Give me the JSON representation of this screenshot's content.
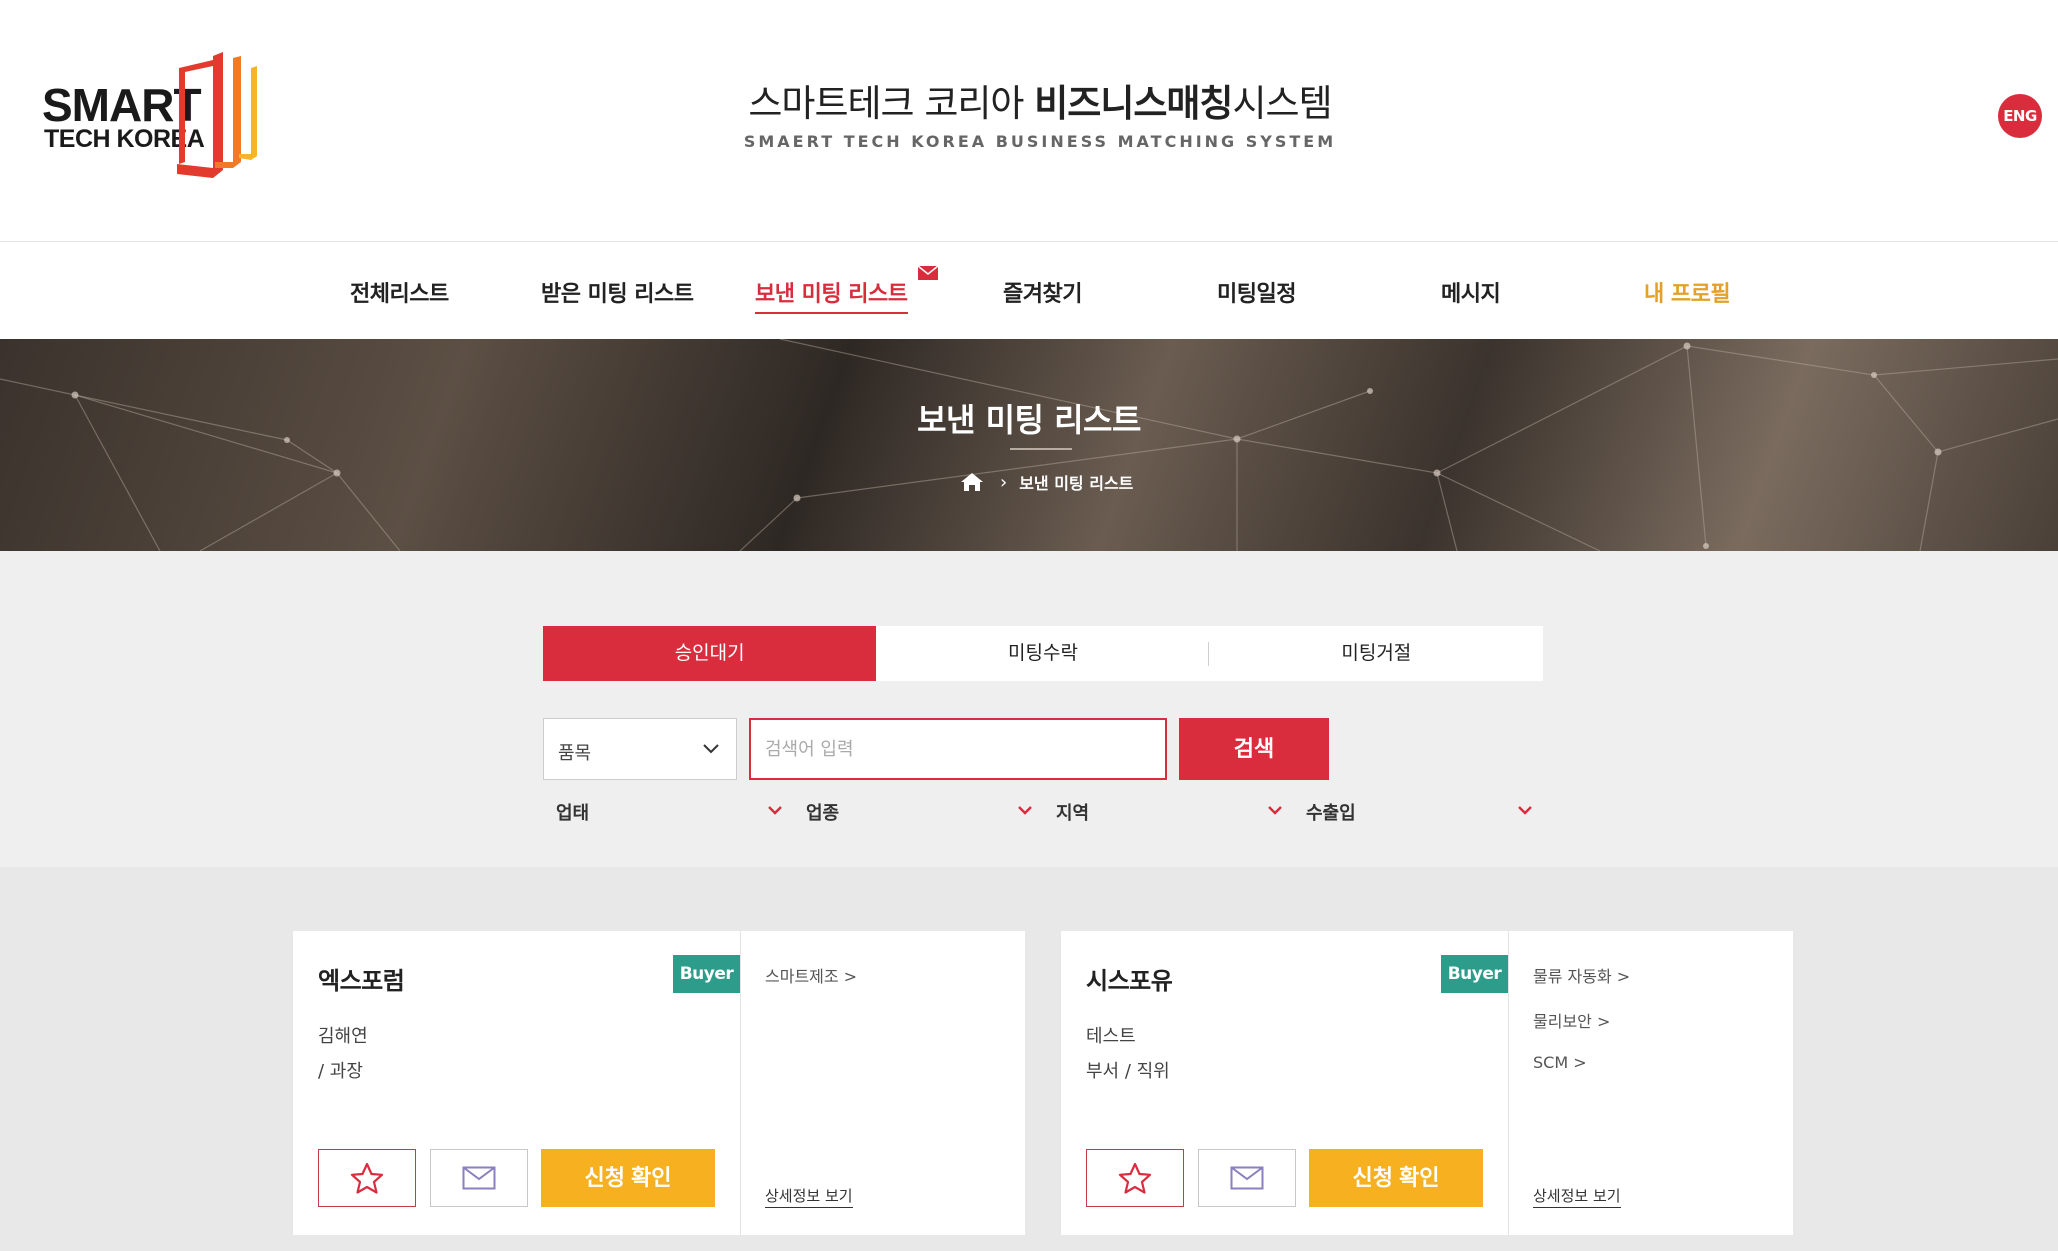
{
  "header": {
    "logo_line1": "SMART",
    "logo_line2": "TECH KOREA",
    "title_part1": "스마트테크 코리아 ",
    "title_bold": "비즈니스매칭",
    "title_part2": "시스템",
    "subtitle": "SMAERT TECH KOREA BUSINESS MATCHING SYSTEM",
    "lang_button": "ENG"
  },
  "nav": {
    "items": [
      {
        "label": "전체리스트"
      },
      {
        "label": "받은 미팅 리스트"
      },
      {
        "label": "보낸 미팅 리스트"
      },
      {
        "label": "즐겨찾기"
      },
      {
        "label": "미팅일정"
      },
      {
        "label": "메시지"
      },
      {
        "label": "내 프로필"
      }
    ]
  },
  "banner": {
    "title": "보낸 미팅 리스트",
    "breadcrumb_current": "보낸 미팅 리스트"
  },
  "tabs": [
    {
      "label": "승인대기"
    },
    {
      "label": "미팅수락"
    },
    {
      "label": "미팅거절"
    }
  ],
  "search": {
    "category_selected": "품목",
    "placeholder": "검색어 입력",
    "button_label": "검색"
  },
  "filters": [
    {
      "label": "업태"
    },
    {
      "label": "업종"
    },
    {
      "label": "지역"
    },
    {
      "label": "수출입"
    }
  ],
  "cards": [
    {
      "company": "엑스포럼",
      "badge": "Buyer",
      "person_line1": "김해연",
      "person_line2": "/ 과장",
      "confirm_label": "신청 확인",
      "categories": [
        "스마트제조 >"
      ],
      "detail_label": "상세정보 보기"
    },
    {
      "company": "시스포유",
      "badge": "Buyer",
      "person_line1": "테스트",
      "person_line2": "부서 / 직위",
      "confirm_label": "신청 확인",
      "categories": [
        "물류 자동화 >",
        "물리보안 >",
        "SCM >"
      ],
      "detail_label": "상세정보 보기"
    }
  ],
  "colors": {
    "accent_red": "#d92d3e",
    "badge_teal": "#2e9c8a",
    "confirm_yellow": "#f6b020",
    "profile_orange": "#e3a12a"
  }
}
